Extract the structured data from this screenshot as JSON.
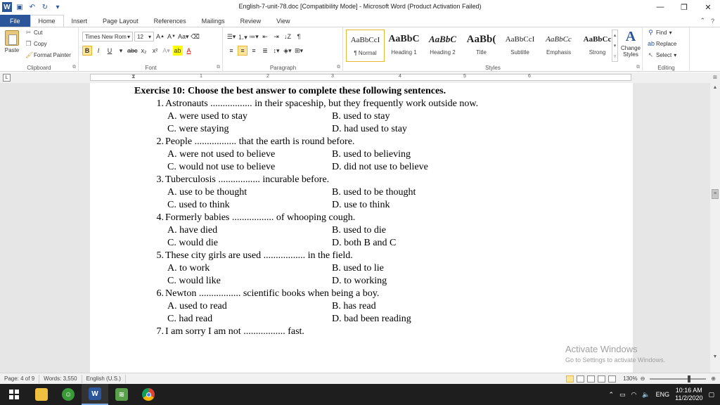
{
  "window": {
    "title": "English-7-unit-78.doc [Compatibility Mode]  -  Microsoft Word (Product Activation Failed)",
    "logo": "W",
    "minimize": "—",
    "restore": "❐",
    "close": "✕"
  },
  "tabs": [
    {
      "label": "File"
    },
    {
      "label": "Home"
    },
    {
      "label": "Insert"
    },
    {
      "label": "Page Layout"
    },
    {
      "label": "References"
    },
    {
      "label": "Mailings"
    },
    {
      "label": "Review"
    },
    {
      "label": "View"
    }
  ],
  "ribbon": {
    "clipboard": {
      "paste": "Paste",
      "cut": "Cut",
      "copy": "Copy",
      "format_painter": "Format Painter",
      "label": "Clipboard"
    },
    "font": {
      "name": "Times New Rom",
      "size": "12",
      "label": "Font"
    },
    "paragraph": {
      "label": "Paragraph"
    },
    "styles": {
      "label": "Styles",
      "items": [
        {
          "sample": "AaBbCcI",
          "name": "¶ Normal"
        },
        {
          "sample": "AaBbC",
          "name": "Heading 1"
        },
        {
          "sample": "AaBbC",
          "name": "Heading 2"
        },
        {
          "sample": "AaBb(",
          "name": "Title"
        },
        {
          "sample": "AaBbCcI",
          "name": "Subtitle"
        },
        {
          "sample": "AaBbCc",
          "name": "Emphasis"
        },
        {
          "sample": "AaBbCc",
          "name": "Strong"
        }
      ],
      "change_styles": "Change Styles"
    },
    "editing": {
      "find": "Find",
      "replace": "Replace",
      "select": "Select",
      "label": "Editing"
    }
  },
  "document": {
    "heading": "Exercise 10: Choose the best answer to complete these following sentences.",
    "questions": [
      {
        "num": "1.",
        "text": "Astronauts ................. in their spaceship, but they frequently work outside now.",
        "a": "A. were used to stay",
        "b": "B. used to stay",
        "c": "C. were staying",
        "d": "D. had used to stay"
      },
      {
        "num": "2.",
        "text": "People ................. that the earth is round before.",
        "a": "A. were not used to believe",
        "b": "B. used to believing",
        "c": "C. would not use to believe",
        "d": "D. did not use to believe"
      },
      {
        "num": "3.",
        "text": "Tuberculosis ................. incurable before.",
        "a": "A. use to be thought",
        "b": "B. used to be thought",
        "c": "C. used to think",
        "d": "D. use to think"
      },
      {
        "num": "4.",
        "text": "Formerly babies ................. of whooping cough.",
        "a": "A. have died",
        "b": "B. used to die",
        "c": "C. would die",
        "d": "D. both B and C"
      },
      {
        "num": "5.",
        "text": "These city girls are used ................. in the field.",
        "a": "A. to work",
        "b": "B. used to lie",
        "c": "C. would like",
        "d": "D. to working"
      },
      {
        "num": "6.",
        "text": "Newton ................. scientific books when being a boy.",
        "a": "A. used to read",
        "b": "B. has read",
        "c": "C. had read",
        "d": "D. bad been reading"
      }
    ],
    "last_question": {
      "num": "7.",
      "text": "I am sorry I am not ................. fast."
    }
  },
  "watermark": {
    "title": "Activate Windows",
    "subtitle": "Go to Settings to activate Windows."
  },
  "status": {
    "page": "Page: 4 of 9",
    "words": "Words: 3,550",
    "language": "English (U.S.)",
    "zoom": "130%"
  },
  "taskbar": {
    "time": "10:16 AM",
    "date": "11/2/2020",
    "lang": "ENG"
  }
}
